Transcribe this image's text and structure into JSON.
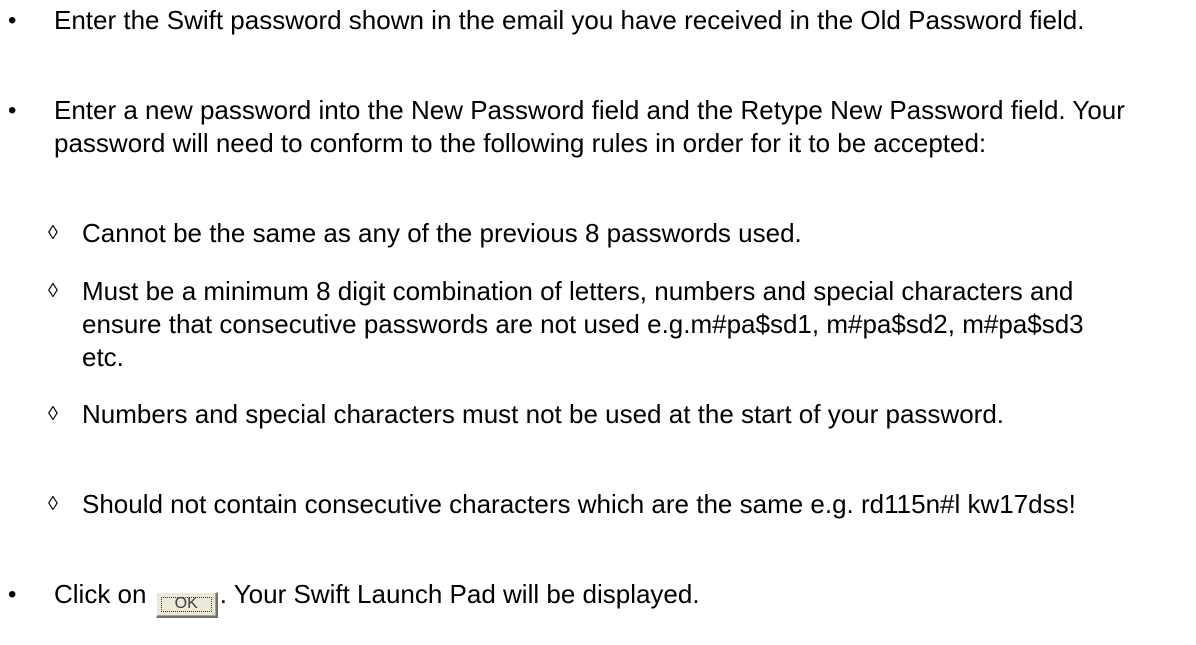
{
  "instructions": {
    "items": [
      {
        "bullet": "•",
        "text": "Enter the Swift password shown in the email you have received in the Old Password field."
      },
      {
        "bullet": "•",
        "text": "Enter a new password into the New Password field and the Retype New Password field.  Your password will need to conform to the following rules in order for it to be accepted:"
      }
    ],
    "rules": [
      {
        "bullet": "◊",
        "text": "Cannot be the same as any of the previous 8 passwords used."
      },
      {
        "bullet": "◊",
        "text": "Must be a minimum 8 digit combination of letters, numbers and special characters and ensure that consecutive passwords are not used e.g.m#pa$sd1, m#pa$sd2, m#pa$sd3 etc."
      },
      {
        "bullet": "◊",
        "text": "Numbers and special characters must not be used at the start of your password."
      },
      {
        "bullet": "◊",
        "text": "Should not contain consecutive characters which are the same e.g. rd115n#l kw17dss!"
      }
    ],
    "final": {
      "bullet": "•",
      "prefix": "Click on",
      "button_label": "OK",
      "suffix": ".  Your Swift Launch Pad will be displayed."
    }
  }
}
